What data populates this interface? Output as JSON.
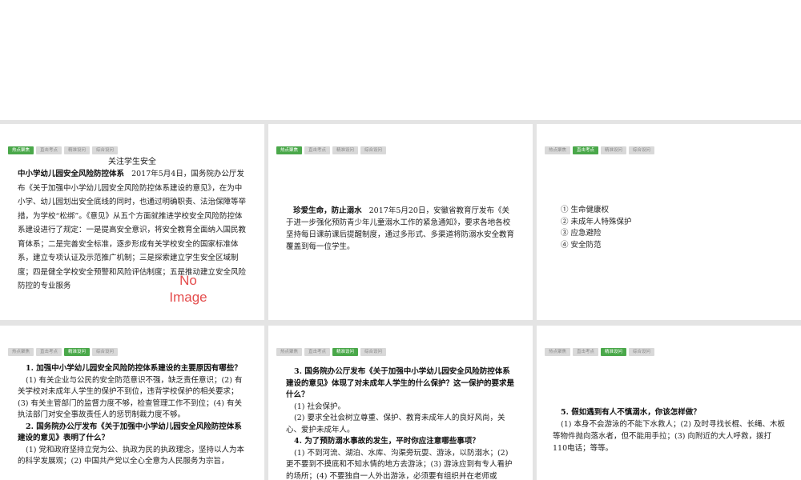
{
  "tabs": [
    "热点聚焦",
    "直击考点",
    "精准设问",
    "综合设问"
  ],
  "slide1": {
    "title": "关注学生安全",
    "heading": "中小学幼儿园安全风险防控体系",
    "body": "2017年5月4日，国务院办公厅发布《关于加强中小学幼儿园安全风险防控体系建设的意见》，在为中小学、幼儿园划出安全底线的同时，也通过明确职责、法治保障等举措，为学校“松绑”。《意见》从五个方面就推进学校安全风险防控体系建设进行了规定：一是提高安全意识，将安全教育全面纳入国民教育体系；二是完善安全标准，逐步形成有关学校安全的国家标准体系，建立专项认证及示范推广机制；三是探索建立学生安全区域制度；四是健全学校安全预警和风险评估制度；五是推动建立安全风险防控的专业服务",
    "placeholder_line1": "No",
    "placeholder_line2": "Image"
  },
  "slide2": {
    "heading": "珍爱生命，防止溺水",
    "body": "2017年5月20日，安徽省教育厅发布《关于进一步强化预防青少年儿童溺水工作的紧急通知》，要求各地各校坚持每日课前课后提醒制度，通过多形式、多渠道将防溺水安全教育覆盖到每一位学生。"
  },
  "slide3": {
    "items": [
      "① 生命健康权",
      "② 未成年人特殊保护",
      "③ 应急避险",
      "④ 安全防范"
    ]
  },
  "slide4": {
    "q1": "1. 加强中小学幼儿园安全风险防控体系建设的主要原因有哪些？",
    "a1": "(1) 有关企业与公民的安全防范意识不强，缺乏责任意识；(2) 有关学校对未成年人学生的保护不到位，违背学校保护的相关要求；(3) 有关主管部门的监督力度不够，检查管理工作不到位；(4) 有关执法部门对安全事故责任人的惩罚制裁力度不够。",
    "q2": "2. 国务院办公厅发布《关于加强中小学幼儿园安全风险防控体系建设的意见》表明了什么？",
    "a2": "(1) 党和政府坚持立党为公、执政为民的执政理念，坚持以人为本的科学发展观；(2) 中国共产党以全心全意为人民服务为宗旨，"
  },
  "slide5": {
    "q3": "3. 国务院办公厅发布《关于加强中小学幼儿园安全风险防控体系建设的意见》体现了对未成年人学生的什么保护？这一保护的要求是什么？",
    "a3_1": "(1) 社会保护。",
    "a3_2": "(2) 要求全社会树立尊重、保护、教育未成年人的良好风尚，关心、爱护未成年人。",
    "q4": "4. 为了预防溺水事故的发生，平时你应注意哪些事项？",
    "a4": "(1) 不到河流、湖泊、水库、沟渠旁玩耍、游泳，以防溺水；(2) 更不要到不摸底和不知水情的地方去游泳；(3) 游泳应到有专人看护的场所；(4) 不要独自一人外出游泳，必须要有组织并在老师或"
  },
  "slide6": {
    "q5": "5. 假如遇到有人不慎溺水，你该怎样做？",
    "a5": "(1) 本身不会游泳的不能下水救人；(2) 及时寻找长棍、长绳、木板等物件抛向落水者，但不能用手拉；(3) 向附近的大人呼救，拨打110电话；等等。"
  },
  "colors": {
    "tab_active": "#4aa84a",
    "tab_inactive": "#d9d9d9",
    "placeholder_text": "#e44c4c"
  }
}
